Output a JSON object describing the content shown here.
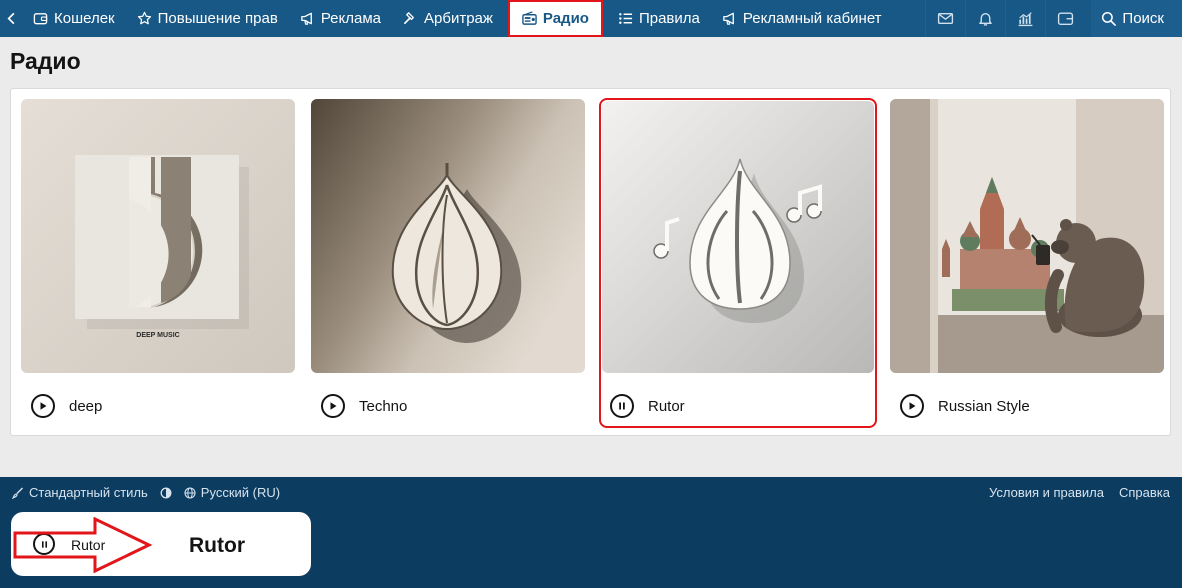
{
  "nav": {
    "items": [
      {
        "label": "Кошелек",
        "icon": "wallet-icon"
      },
      {
        "label": "Повышение прав",
        "icon": "star-icon"
      },
      {
        "label": "Реклама",
        "icon": "megaphone-icon"
      },
      {
        "label": "Арбитраж",
        "icon": "gavel-icon"
      },
      {
        "label": "Радио",
        "icon": "radio-icon",
        "active": true
      },
      {
        "label": "Правила",
        "icon": "list-icon"
      },
      {
        "label": "Рекламный кабинет",
        "icon": "megaphone-icon"
      }
    ],
    "right_icons": [
      "envelope-icon",
      "bell-icon",
      "chart-icon",
      "wallet-icon"
    ],
    "search_label": "Поиск"
  },
  "page": {
    "title": "Радио"
  },
  "stations": [
    {
      "name": "deep",
      "art_text": "DEEP MUSIC",
      "state": "play"
    },
    {
      "name": "Techno",
      "state": "play"
    },
    {
      "name": "Rutor",
      "state": "pause",
      "selected": true
    },
    {
      "name": "Russian Style",
      "state": "play"
    }
  ],
  "footer": {
    "style_label": "Стандартный стиль",
    "language_label": "Русский (RU)",
    "terms_label": "Условия и правила",
    "help_label": "Справка"
  },
  "player": {
    "small_name": "Rutor",
    "big_name": "Rutor",
    "state": "pause"
  },
  "colors": {
    "nav_bg": "#185886",
    "footer_bg": "#0d3c61",
    "highlight": "#e2151b",
    "page_bg": "#ebebeb"
  }
}
